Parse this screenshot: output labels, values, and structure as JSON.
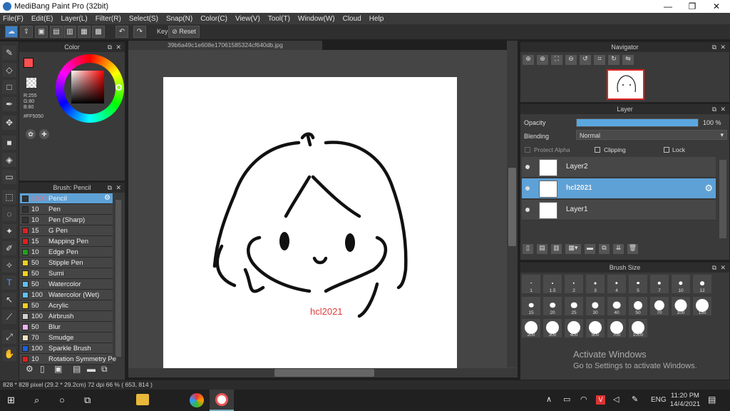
{
  "titlebar": {
    "title": "MediBang Paint Pro (32bit)",
    "min": "—",
    "max": "❐",
    "close": "✕"
  },
  "menu": [
    "File(F)",
    "Edit(E)",
    "Layer(L)",
    "Filter(R)",
    "Select(S)",
    "Snap(N)",
    "Color(C)",
    "View(V)",
    "Tool(T)",
    "Window(W)",
    "Cloud",
    "Help"
  ],
  "toolbar": {
    "key_label": "Key",
    "reset_label": "Reset"
  },
  "color_panel": {
    "title": "Color",
    "r": "R:255",
    "g": "G:80",
    "b": "B:80",
    "hex": "#FF5050",
    "accent": "#ff5050"
  },
  "brush_panel": {
    "title": "Brush: Pencil",
    "items": [
      {
        "size": "1000",
        "name": "Pencil",
        "color": "#333333",
        "selected": true
      },
      {
        "size": "10",
        "name": "Pen",
        "color": "#333333"
      },
      {
        "size": "10",
        "name": "Pen (Sharp)",
        "color": "#333333"
      },
      {
        "size": "15",
        "name": "G Pen",
        "color": "#e02020"
      },
      {
        "size": "15",
        "name": "Mapping Pen",
        "color": "#e02020"
      },
      {
        "size": "10",
        "name": "Edge Pen",
        "color": "#20a020"
      },
      {
        "size": "50",
        "name": "Stipple Pen",
        "color": "#f0d020"
      },
      {
        "size": "50",
        "name": "Sumi",
        "color": "#f0d020"
      },
      {
        "size": "50",
        "name": "Watercolor",
        "color": "#60c0f0"
      },
      {
        "size": "100",
        "name": "Watercolor (Wet)",
        "color": "#60c0f0"
      },
      {
        "size": "50",
        "name": "Acrylic",
        "color": "#f0d020"
      },
      {
        "size": "100",
        "name": "Airbrush",
        "color": "#cfcfcf"
      },
      {
        "size": "50",
        "name": "Blur",
        "color": "#f0b0f0"
      },
      {
        "size": "70",
        "name": "Smudge",
        "color": "#f5e0c0"
      },
      {
        "size": "100",
        "name": "Sparkle Brush",
        "color": "#2060e0"
      },
      {
        "size": "10",
        "name": "Rotation Symmetry Pe",
        "color": "#e02020"
      }
    ]
  },
  "canvas": {
    "tab_title": "39b6a49c1e608e17061585324cf640db.jpg",
    "signature": "hcl2021"
  },
  "navigator": {
    "title": "Navigator"
  },
  "layer_panel": {
    "title": "Layer",
    "opacity_label": "Opacity",
    "opacity_value": "100 %",
    "opacity": 1.0,
    "blending_label": "Blending",
    "blending_value": "Normal",
    "protect_alpha": "Protect Alpha",
    "clipping": "Clipping",
    "lock": "Lock",
    "layers": [
      {
        "name": "Layer2",
        "selected": false
      },
      {
        "name": "hcl2021",
        "selected": true
      },
      {
        "name": "Layer1",
        "selected": false
      }
    ]
  },
  "brush_size_panel": {
    "title": "Brush Size",
    "sizes": [
      "1",
      "1.5",
      "2",
      "3",
      "4",
      "5",
      "7",
      "10",
      "12",
      "15",
      "20",
      "25",
      "30",
      "40",
      "50",
      "70",
      "100",
      "150",
      "200",
      "300",
      "400",
      "500",
      "700",
      "1000"
    ]
  },
  "watermark": {
    "line1": "Activate Windows",
    "line2": "Go to Settings to activate Windows."
  },
  "status": {
    "text": "828 * 828 pixel  (29.2 * 29.2cm)  72 dpi  66 %  ( 653, 814 )"
  },
  "taskbar": {
    "lang": "ENG",
    "time": "11:20 PM",
    "date": "14/4/2021"
  }
}
